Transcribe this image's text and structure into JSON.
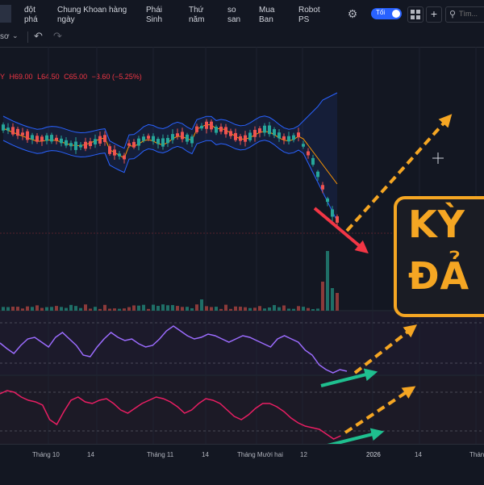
{
  "header": {
    "nav": [
      {
        "id": "dot-pha",
        "label": "đột\nphá"
      },
      {
        "id": "chung-khoan",
        "label": "Chung Khoan hàng\nngày"
      },
      {
        "id": "phai-sinh",
        "label": "Phái\nSinh"
      },
      {
        "id": "thu-nam",
        "label": "Thứ\nnăm"
      },
      {
        "id": "so-san",
        "label": "so\nsan"
      },
      {
        "id": "mua-ban",
        "label": "Mua\nBan"
      },
      {
        "id": "robot-ps",
        "label": "Robot\nPS"
      }
    ],
    "theme_toggle_label": "Tối",
    "search_placeholder": "Tìm..."
  },
  "toolbar": {
    "chart_type_text": "sơ"
  },
  "ohlc": {
    "o_label": "Y",
    "h": "H69.00",
    "l": "L64.50",
    "c": "C65.00",
    "change": "−3.60 (−5.25%)",
    "colors": {
      "label": "#f23645",
      "value": "#f23645"
    }
  },
  "x_axis": {
    "ticks": [
      {
        "label": "Tháng 10",
        "pos": "t1"
      },
      {
        "label": "14",
        "pos": "t2"
      },
      {
        "label": "Tháng 11",
        "pos": "t3"
      },
      {
        "label": "14",
        "pos": "t4"
      },
      {
        "label": "Tháng Mười hai",
        "pos": "t5"
      },
      {
        "label": "12",
        "pos": "t6"
      },
      {
        "label": "2026",
        "pos": "t7"
      },
      {
        "label": "14",
        "pos": "t8"
      },
      {
        "label": "Tháng",
        "pos": "t9"
      }
    ]
  },
  "banner": {
    "line1": "KỲ",
    "line2": "ĐẢ"
  },
  "colors": {
    "background": "#131722",
    "up": "#26a69a",
    "down": "#ef5350",
    "bollinger": "#2962ff",
    "ma": "#ff9800",
    "rsi": "#9c6cff",
    "stoch": "#e91e63",
    "arrow_orange": "#f5a623",
    "arrow_red": "#f23645",
    "arrow_green": "#1fbf8f"
  }
}
